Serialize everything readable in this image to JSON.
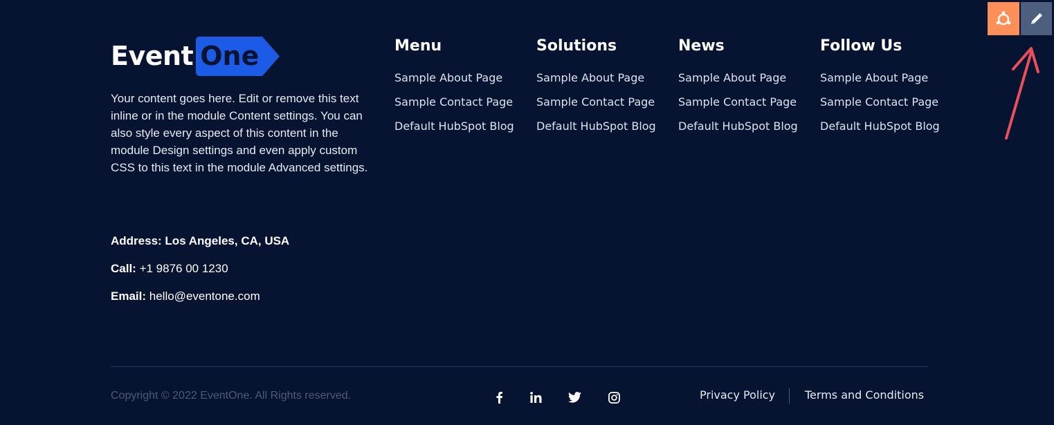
{
  "brand": {
    "word1": "Event",
    "word2": "One",
    "tag_color": "#1c5be6"
  },
  "about": {
    "text": "Your content goes here. Edit or remove this text inline or in the module Content settings. You can also style every aspect of this content in the module Design settings and even apply custom CSS to this text in the module Advanced settings."
  },
  "contact": {
    "address_label": "Address:",
    "address_value": "Los Angeles, CA, USA",
    "call_label": "Call:",
    "call_value": "+1 9876 00 1230",
    "email_label": "Email:",
    "email_value": "hello@eventone.com"
  },
  "columns": [
    {
      "title": "Menu",
      "links": [
        "Sample About Page",
        "Sample Contact Page",
        "Default HubSpot Blog"
      ]
    },
    {
      "title": "Solutions",
      "links": [
        "Sample About Page",
        "Sample Contact Page",
        "Default HubSpot Blog"
      ]
    },
    {
      "title": "News",
      "links": [
        "Sample About Page",
        "Sample Contact Page",
        "Default HubSpot Blog"
      ]
    },
    {
      "title": "Follow Us",
      "links": [
        "Sample About Page",
        "Sample Contact Page",
        "Default HubSpot Blog"
      ]
    }
  ],
  "footer": {
    "copyright": "Copyright © 2022 EventOne. All Rights reserved.",
    "social_icons": [
      "facebook-icon",
      "linkedin-icon",
      "twitter-icon",
      "instagram-icon"
    ],
    "privacy": "Privacy Policy",
    "terms": "Terms and Conditions"
  },
  "toolbar": {
    "icons": [
      "hubspot-sprocket-icon",
      "pencil-icon"
    ],
    "accent": "#ff8f59"
  },
  "colors": {
    "background": "#061431",
    "annotation_arrow": "#e8505b"
  }
}
